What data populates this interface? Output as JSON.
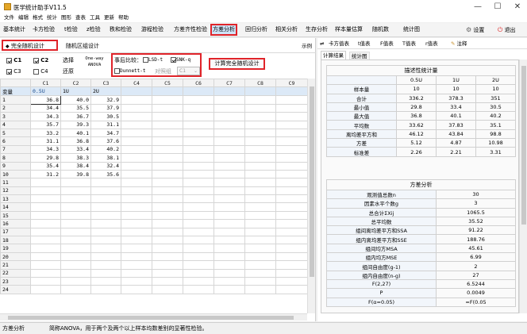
{
  "window": {
    "title": "医学统计助手V11.5",
    "minimize": "—",
    "maximize": "☐",
    "close": "✕"
  },
  "menu": [
    "文件",
    "编辑",
    "格式",
    "统计",
    "图形",
    "查表",
    "工具",
    "更新",
    "帮助"
  ],
  "nav": {
    "items": [
      "基本统计",
      "卡方检验",
      "t检验",
      "z检验",
      "秩和检验",
      "游程检验",
      "方差齐性检验",
      "方差分析",
      "回归分析",
      "相关分析",
      "生存分析",
      "样本量估算",
      "随机数",
      "统计图"
    ],
    "active_index": 7,
    "settings": "设置",
    "exit": "退出"
  },
  "left": {
    "tabs": [
      "完全随机设计",
      "随机区组设计"
    ],
    "active_tab": 0,
    "demo": "示例",
    "columns_check": [
      {
        "label": "C1",
        "checked": true
      },
      {
        "label": "C2",
        "checked": true
      },
      {
        "label": "C3",
        "checked": true
      },
      {
        "label": "C4",
        "checked": false
      }
    ],
    "select_label": "选择",
    "restore_label": "还原",
    "method": "One-way\nANOVA",
    "posthoc": {
      "label": "事后比较：",
      "lsd": {
        "label": "LSD-t",
        "checked": false
      },
      "snk": {
        "label": "SNK-q",
        "checked": true
      },
      "dunnett": {
        "label": "Dunnett-t",
        "checked": false
      },
      "control_label": "对照组",
      "control_value": "C1"
    },
    "compute_button": "计算完全随机设计",
    "grid": {
      "columns": [
        "C1",
        "C2",
        "C3",
        "C4",
        "C5",
        "C6",
        "C7",
        "C8",
        "C9"
      ],
      "header_row": {
        "label": "变量",
        "values": [
          "0.5U",
          "1U",
          "2U",
          "",
          "",
          "",
          "",
          "",
          ""
        ]
      },
      "rows": [
        [
          "36.8",
          "40.0",
          "32.9"
        ],
        [
          "34.4",
          "35.5",
          "37.9"
        ],
        [
          "34.3",
          "36.7",
          "30.5"
        ],
        [
          "35.7",
          "39.3",
          "31.1"
        ],
        [
          "33.2",
          "40.1",
          "34.7"
        ],
        [
          "31.1",
          "36.8",
          "37.6"
        ],
        [
          "34.3",
          "33.4",
          "40.2"
        ],
        [
          "29.8",
          "38.3",
          "38.1"
        ],
        [
          "35.4",
          "38.4",
          "32.4"
        ],
        [
          "31.2",
          "39.8",
          "35.6"
        ],
        [],
        [],
        [],
        [],
        [],
        [],
        [],
        [],
        [],
        [],
        [],
        [],
        [],
        []
      ]
    }
  },
  "right": {
    "toolbar": [
      "卡方值表",
      "t值表",
      "F值表",
      "T值表",
      "r值表",
      "注释"
    ],
    "tabs": [
      "计算结果",
      "统计图"
    ],
    "active_tab": 0,
    "desc": {
      "title": "描述性统计量",
      "headers": [
        "",
        "0.5U",
        "1U",
        "2U"
      ],
      "rows": [
        [
          "样本量",
          "10",
          "10",
          "10"
        ],
        [
          "合计",
          "336.2",
          "378.3",
          "351"
        ],
        [
          "最小值",
          "29.8",
          "33.4",
          "30.5"
        ],
        [
          "最大值",
          "36.8",
          "40.1",
          "40.2"
        ],
        [
          "平均数",
          "33.62",
          "37.83",
          "35.1"
        ],
        [
          "离均差平方和",
          "46.12",
          "43.84",
          "98.8"
        ],
        [
          "方差",
          "5.12",
          "4.87",
          "10.98"
        ],
        [
          "标准差",
          "2.26",
          "2.21",
          "3.31"
        ]
      ]
    },
    "anova": {
      "title": "方差分析",
      "rows": [
        [
          "观测值总数n",
          "30"
        ],
        [
          "因素水平个数g",
          "3"
        ],
        [
          "总合计ΣXij",
          "1065.5"
        ],
        [
          "总平均数",
          "35.52"
        ],
        [
          "组间离均差平方和SSA",
          "91.22"
        ],
        [
          "组内离均差平方和SSE",
          "188.76"
        ],
        [
          "组间均方MSA",
          "45.61"
        ],
        [
          "组内均方MSE",
          "6.99"
        ],
        [
          "组间自由度(g-1)",
          "2"
        ],
        [
          "组内自由度(n-g)",
          "27"
        ],
        [
          "F(2,27)",
          "6.5244"
        ],
        [
          "P",
          "0.0049"
        ],
        [
          "F(α=0.05)",
          "=F(0.05"
        ]
      ]
    }
  },
  "status": {
    "left": "方差分析",
    "text": "简称ANOVA，用于两个及两个以上样本均数差别的显著性检验。"
  },
  "colors": {
    "accent": "#e0242a",
    "selected_tab_bg": "#cfe3f7",
    "header_row_bg": "#dce9f7"
  }
}
